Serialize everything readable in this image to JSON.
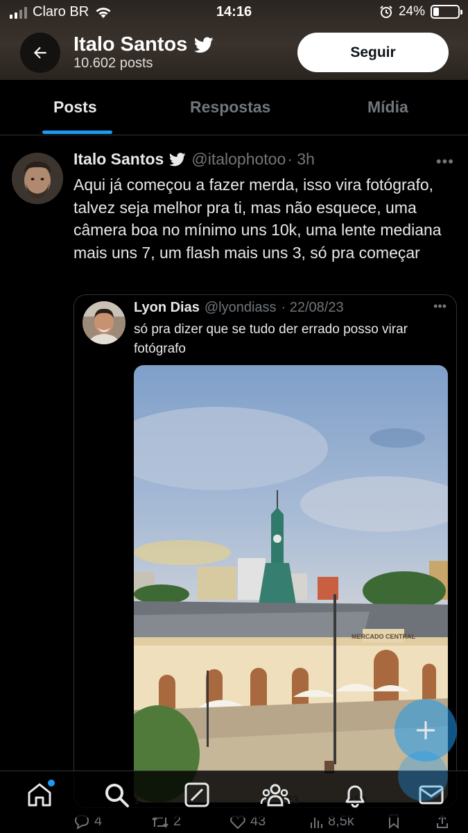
{
  "status_bar": {
    "carrier": "Claro BR",
    "time": "14:16",
    "battery_percent": "24%",
    "battery_level": 0.24,
    "icons": [
      "signal-icon",
      "wifi-icon",
      "alarm-icon",
      "battery-icon"
    ]
  },
  "profile": {
    "name": "Italo Santos",
    "post_count": "10.602 posts",
    "follow_label": "Seguir",
    "verified": true
  },
  "tabs": [
    {
      "label": "Posts",
      "active": true
    },
    {
      "label": "Respostas",
      "active": false
    },
    {
      "label": "Mídia",
      "active": false
    }
  ],
  "tweet": {
    "author": "Italo Santos",
    "handle": "@italophotoo",
    "time": "· 3h",
    "text": "Aqui já começou a fazer merda, isso vira fotógrafo, talvez seja melhor pra ti, mas não esquece, uma câmera boa no mínimo uns 10k, uma lente mediana mais uns 7, um flash mais uns 3, só pra começar",
    "quote": {
      "author": "Lyon Dias",
      "handle": "@lyondiass",
      "date": "· 22/08/23",
      "text": "só pra dizer que se tudo der errado posso virar fotógrafo",
      "image_signage": "MERCADO CENTRAL",
      "action_counts": {
        "replies": "1",
        "retweets": "23",
        "views": "919"
      }
    },
    "actions": {
      "replies": "4",
      "retweets": "2",
      "likes": "43",
      "views": "8,5k"
    }
  },
  "colors": {
    "accent": "#1d9bf0",
    "background": "#000000",
    "text": "#e7e9ea",
    "muted": "#71767b"
  },
  "bottom_nav": [
    "home-icon",
    "search-icon",
    "grok-icon",
    "communities-icon",
    "notifications-icon",
    "messages-icon"
  ]
}
